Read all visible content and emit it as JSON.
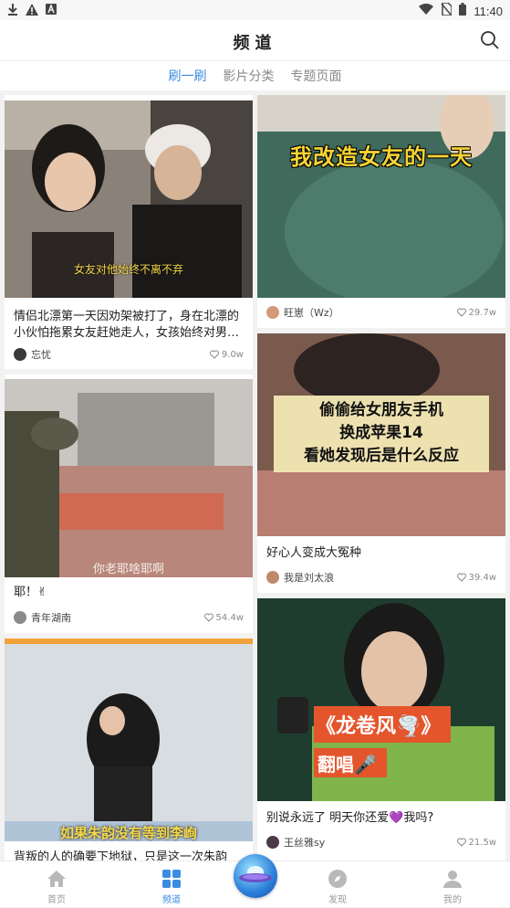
{
  "status_bar": {
    "time": "11:40"
  },
  "header": {
    "title": "频道"
  },
  "subtabs": [
    {
      "label": "刷一刷",
      "active": true
    },
    {
      "label": "影片分类",
      "active": false
    },
    {
      "label": "专题页面",
      "active": false
    }
  ],
  "cards_left": [
    {
      "overlay_text": "女友对他始终不离不弃",
      "caption": "情侣北漂第一天因劝架被打了，身在北漂的小伙怕拖累女友赶她走人，女孩始终对男…",
      "author": "忘忧",
      "likes": "9.0w"
    },
    {
      "overlay_text": "你老耶啥耶啊",
      "caption": "耶！✌",
      "author": "青年湖南",
      "likes": "54.4w"
    },
    {
      "overlay_text": "如果朱韵没有等到李峋",
      "caption": "背叛的人的确要下地狱，只是这一次朱韵"
    }
  ],
  "cards_right": [
    {
      "overlay_text": "我改造女友的一天",
      "author": "旺崽（Wz）",
      "likes": "29.7w"
    },
    {
      "overlay_lines": [
        "偷偷给女朋友手机",
        "换成苹果14",
        "看她发现后是什么反应"
      ],
      "caption": "好心人变成大冤种",
      "author": "我是刘太浪",
      "likes": "39.4w"
    },
    {
      "overlay_text": "《龙卷风🌪️》",
      "overlay_sub": "翻唱🎤",
      "caption": "别说永远了 明天你还爱💜我吗?",
      "author": "王丝雅sy",
      "likes": "21.5w"
    }
  ],
  "bottom_nav": [
    {
      "label": "首页",
      "icon": "home-icon",
      "active": false
    },
    {
      "label": "频道",
      "icon": "grid-icon",
      "active": true
    },
    {
      "label": "发现",
      "icon": "compass-icon",
      "active": false
    },
    {
      "label": "我的",
      "icon": "user-icon",
      "active": false
    }
  ],
  "colors": {
    "accent": "#3c8de0",
    "tab_inactive": "#8a8a8a"
  }
}
